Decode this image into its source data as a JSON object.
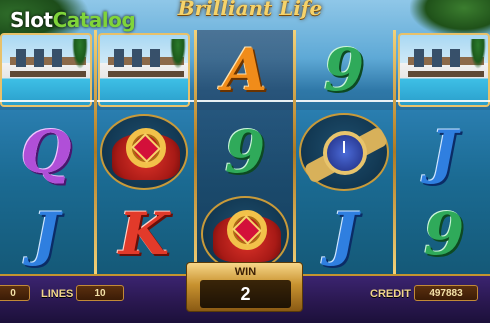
{
  "game": {
    "title": "Brilliant Life",
    "watermark": {
      "part1": "Slot",
      "part2": "Catalog"
    }
  },
  "reels": [
    [
      "villa",
      "Q",
      "J"
    ],
    [
      "villa",
      "ring",
      "K"
    ],
    [
      "A",
      "9",
      "ring"
    ],
    [
      "9",
      "watch",
      "J"
    ],
    [
      "villa",
      "J",
      "9"
    ]
  ],
  "bottom_bar": {
    "bet_value_partial": "0",
    "lines_label": "LINES",
    "lines_value": "10",
    "win_label": "WIN",
    "win_value": "2",
    "credit_label": "CREDIT",
    "credit_value": "497883"
  },
  "colors": {
    "gold": "#c4952f",
    "panel": "#2a1850"
  }
}
